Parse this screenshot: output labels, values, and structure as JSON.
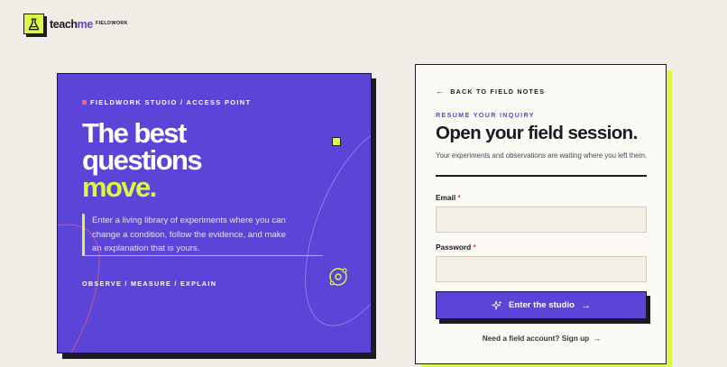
{
  "brand": {
    "name_main": "teach",
    "name_accent": "me",
    "sub": "FIELDWORK",
    "icon": "flask-icon"
  },
  "hero": {
    "eyebrow": "FIELDWORK STUDIO / ACCESS POINT",
    "title_line1": "The best",
    "title_line2": "questions",
    "title_accent": "move.",
    "description": "Enter a living library of experiments where you can change a condition, follow the evidence, and make an explanation that is yours.",
    "footer": "OBSERVE / MEASURE / EXPLAIN",
    "orbit_icon": "orbit-icon"
  },
  "form": {
    "back_label": "BACK TO FIELD NOTES",
    "eyebrow": "RESUME YOUR INQUIRY",
    "title": "Open your field session.",
    "subtitle": "Your experiments and observations are waiting where you left them.",
    "email_label": "Email",
    "email_value": "",
    "password_label": "Password",
    "password_value": "",
    "required_mark": "*",
    "submit_label": "Enter the studio",
    "signup_label": "Need a field account? Sign up"
  },
  "colors": {
    "background": "#f1ede6",
    "primary": "#5b44d8",
    "accent": "#dbf748",
    "ink": "#1c1a22",
    "dot": "#ff6160",
    "required": "#e8414a"
  }
}
